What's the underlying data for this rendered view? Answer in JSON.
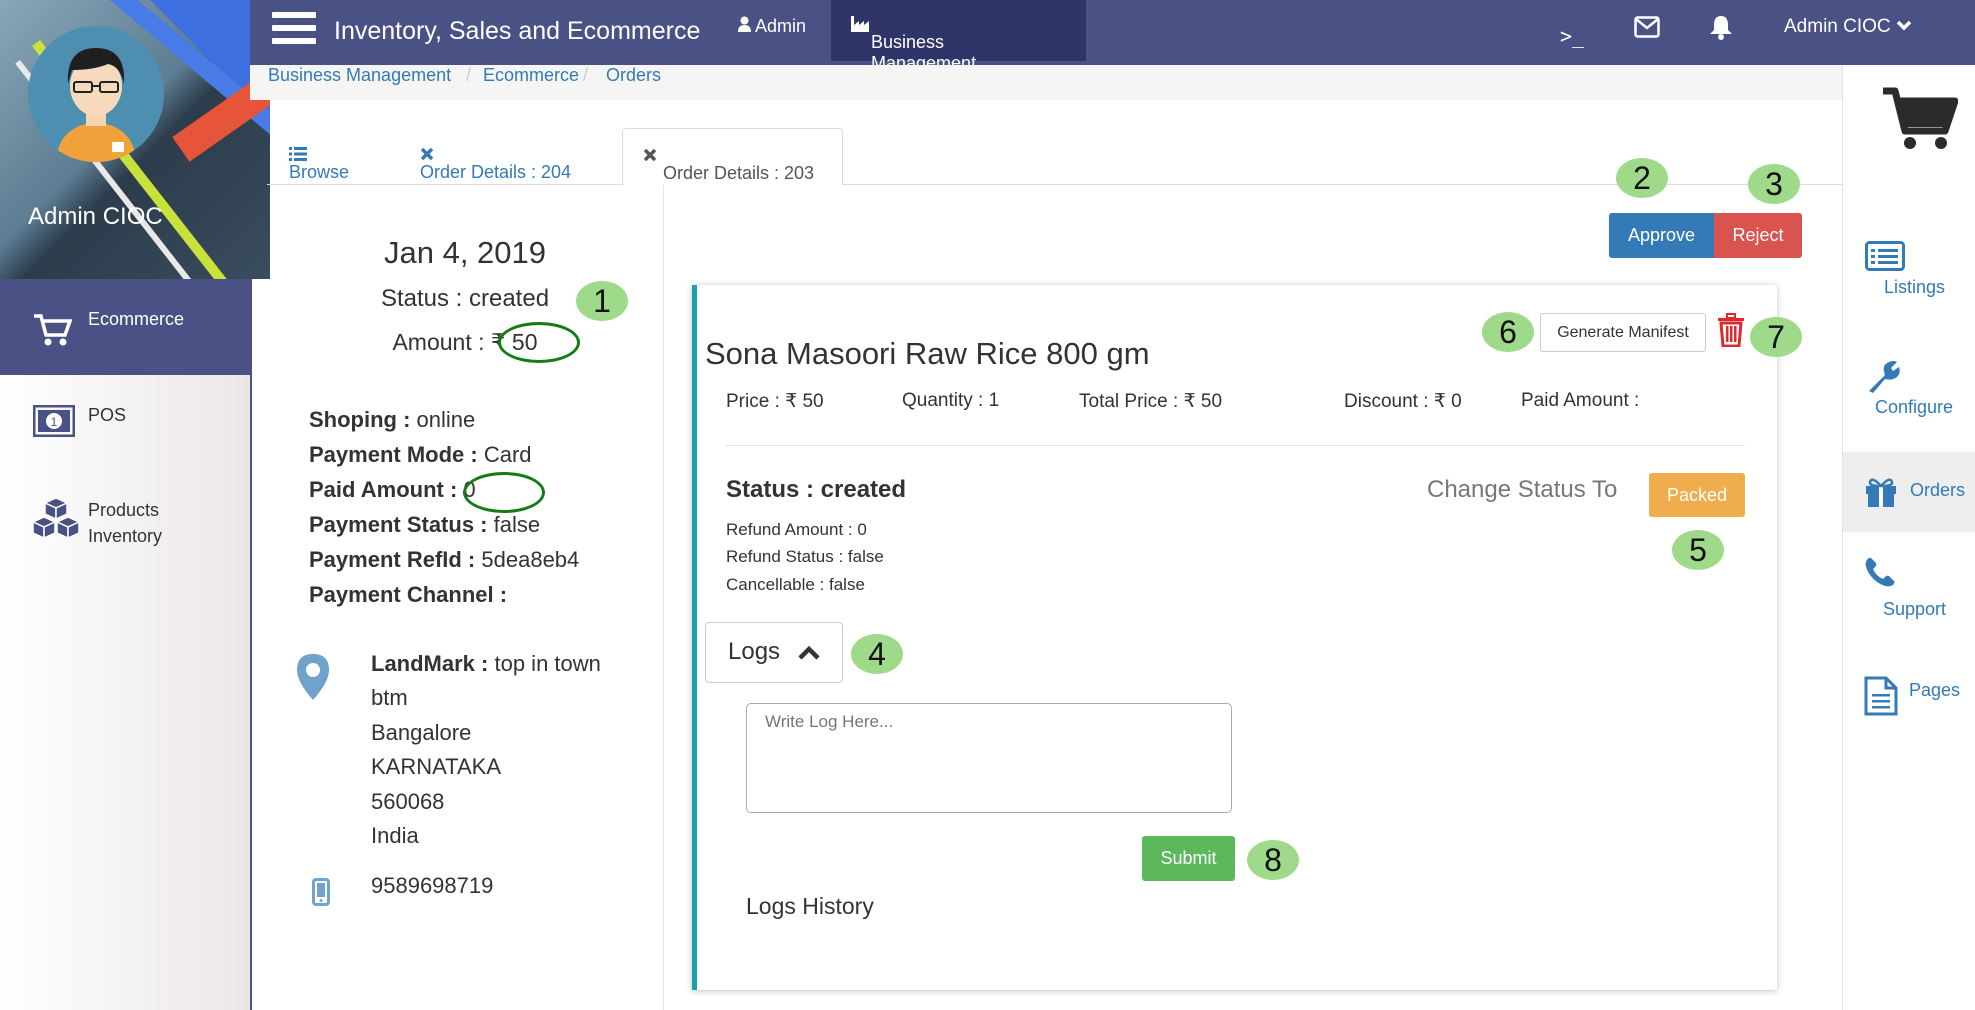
{
  "app": {
    "title": "Inventory, Sales and Ecommerce"
  },
  "topnav": {
    "admin": "Admin",
    "business_management": "Business Management",
    "terminal": ">_",
    "user_menu": "Admin CIOC"
  },
  "profile": {
    "name": "Admin CIOC"
  },
  "sidebar": {
    "items": [
      {
        "label": "Ecommerce"
      },
      {
        "label": "POS"
      },
      {
        "label": "Products"
      },
      {
        "label": "Inventory"
      }
    ]
  },
  "breadcrumb": [
    "Business Management",
    "Ecommerce",
    "Orders"
  ],
  "tabs": [
    {
      "label": "Browse"
    },
    {
      "label": "Order Details : 204"
    },
    {
      "label": "Order Details : 203"
    }
  ],
  "order": {
    "date": "Jan 4, 2019",
    "status": "Status : created",
    "amount_label": "Amount :",
    "amount_value": "₹ 50",
    "fields": [
      {
        "key": "Shoping :",
        "value": "online"
      },
      {
        "key": "Payment Mode :",
        "value": "Card"
      },
      {
        "key": "Paid Amount :",
        "value": "0"
      },
      {
        "key": "Payment Status :",
        "value": "false"
      },
      {
        "key": "Payment RefId :",
        "value": "5dea8eb4"
      },
      {
        "key": "Payment Channel :",
        "value": ""
      }
    ],
    "address": {
      "landmark_key": "LandMark :",
      "landmark_value": "top in town",
      "lines": [
        "btm",
        "Bangalore",
        "KARNATAKA",
        "560068",
        "India"
      ]
    },
    "phone": "9589698719"
  },
  "actions": {
    "approve": "Approve",
    "reject": "Reject"
  },
  "product": {
    "title": "Sona Masoori Raw Rice 800 gm",
    "price": "Price : ₹ 50",
    "quantity": "Quantity : 1",
    "total_price": "Total Price : ₹ 50",
    "discount": "Discount : ₹ 0",
    "paid_amount": "Paid Amount :",
    "generate_manifest": "Generate Manifest",
    "status": "Status : created",
    "refund_amount": "Refund Amount : 0",
    "refund_status": "Refund Status : false",
    "cancellable": "Cancellable : false",
    "change_status_label": "Change Status To",
    "change_status_button": "Packed"
  },
  "logs": {
    "toggle_label": "Logs",
    "placeholder": "Write Log Here...",
    "submit": "Submit",
    "history_title": "Logs History"
  },
  "right_sidebar": {
    "items": [
      {
        "label": "Listings"
      },
      {
        "label": "Configure"
      },
      {
        "label": "Orders"
      },
      {
        "label": "Support"
      },
      {
        "label": "Pages"
      }
    ]
  },
  "annotations": [
    "1",
    "2",
    "3",
    "4",
    "5",
    "6",
    "7",
    "8"
  ],
  "colors": {
    "navbar": "#4a5285",
    "primary": "#337ab7",
    "danger": "#d9534f",
    "warning": "#f0ad4e",
    "success": "#5cb85c",
    "badge": "#9fd98a",
    "panel_accent": "#1aa0a8"
  }
}
